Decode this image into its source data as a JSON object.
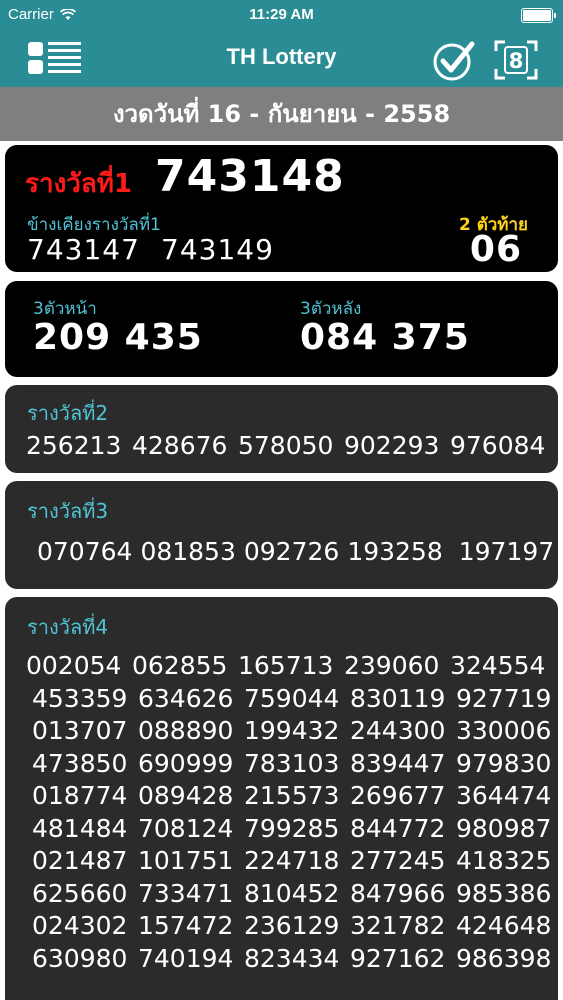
{
  "status_bar": {
    "carrier": "Carrier",
    "time": "11:29 AM"
  },
  "nav": {
    "title": "TH Lottery",
    "menu_icon": "list-menu-icon",
    "check_icon": "check-circle-icon",
    "scan_icon": "scan-8-icon",
    "scan_digit": "8"
  },
  "draw_date": "งวดวันที่ 16 - กันยายน - 2558",
  "prize1": {
    "label": "รางวัลที่1",
    "number": "743148",
    "adjacent_label": "ข้างเคียงรางวัลที่1",
    "adjacent": [
      "743147",
      "743149"
    ],
    "last2_label": "2 ตัวท้าย",
    "last2": "06"
  },
  "three_digit": {
    "front_label": "3ตัวหน้า",
    "front": "209 435",
    "back_label": "3ตัวหลัง",
    "back": "084 375"
  },
  "prize2": {
    "label": "รางวัลที่2",
    "numbers": [
      "256213",
      "428676",
      "578050",
      "902293",
      "976084"
    ]
  },
  "prize3": {
    "label": "รางวัลที่3",
    "numbers": [
      "070764",
      "081853",
      "092726",
      "193258",
      "197197"
    ]
  },
  "prize4": {
    "label": "รางวัลที่4",
    "rows": [
      [
        "002054",
        "062855",
        "165713",
        "239060",
        "324554"
      ],
      [
        "453359",
        "634626",
        "759044",
        "830119",
        "927719"
      ],
      [
        "013707",
        "088890",
        "199432",
        "244300",
        "330006"
      ],
      [
        "473850",
        "690999",
        "783103",
        "839447",
        "979830"
      ],
      [
        "018774",
        "089428",
        "215573",
        "269677",
        "364474"
      ],
      [
        "481484",
        "708124",
        "799285",
        "844772",
        "980987"
      ],
      [
        "021487",
        "101751",
        "224718",
        "277245",
        "418325"
      ],
      [
        "625660",
        "733471",
        "810452",
        "847966",
        "985386"
      ],
      [
        "024302",
        "157472",
        "236129",
        "321782",
        "424648"
      ],
      [
        "630980",
        "740194",
        "823434",
        "927162",
        "986398"
      ]
    ]
  }
}
